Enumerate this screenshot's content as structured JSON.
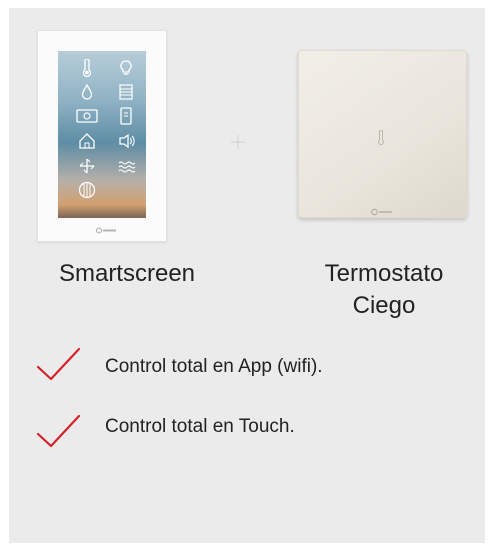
{
  "products": {
    "smartscreen": {
      "name": "Smartscreen",
      "logo_text": "airzone"
    },
    "termostato": {
      "name": "Termostato\nCiego",
      "logo_text": "airzone"
    }
  },
  "separator_icon": "plus-icon",
  "features": [
    {
      "label": "Control total en App (wifi).",
      "icon": "check-icon"
    },
    {
      "label": "Control total en Touch.",
      "icon": "check-icon"
    }
  ],
  "colors": {
    "background": "#ebebeb",
    "check": "#d3222a",
    "text": "#222222"
  }
}
